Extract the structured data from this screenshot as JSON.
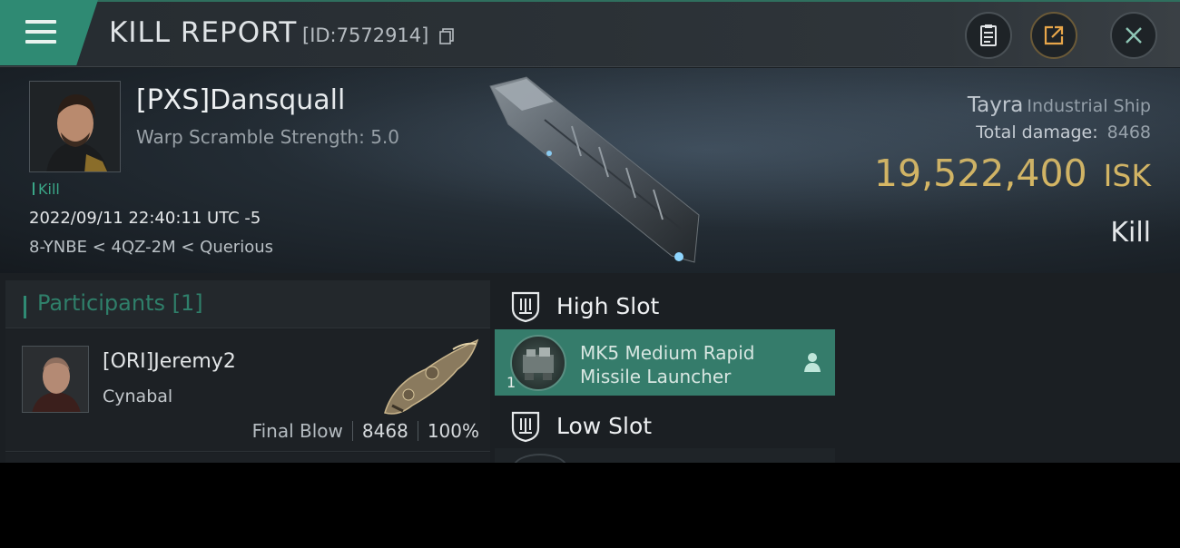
{
  "header": {
    "title": "KILL REPORT",
    "report_id": "[ID:7572914]",
    "icons": [
      "hamburger-menu-icon",
      "clipboard-icon",
      "share-icon",
      "close-icon"
    ]
  },
  "victim": {
    "name": "[PXS]Dansquall",
    "subtitle": "Warp Scramble Strength: 5.0",
    "kill_tag": "Kill",
    "datetime": "2022/09/11 22:40:11 UTC -5",
    "location": "8-YNBE < 4QZ-2M < Querious",
    "ship_name": "Tayra",
    "ship_class": "Industrial Ship",
    "total_damage_label": "Total damage:",
    "total_damage": "8468",
    "isk_value": "19,522,400",
    "isk_unit": "ISK",
    "result": "Kill"
  },
  "participants": {
    "title": "Participants [1]",
    "items": [
      {
        "name": "[ORI]Jeremy2",
        "ship": "Cynabal",
        "final_blow_label": "Final Blow",
        "damage": "8468",
        "percent": "100%"
      }
    ]
  },
  "slots": {
    "high": {
      "title": "High Slot",
      "items": [
        {
          "qty": "1",
          "name": "MK5 Medium Rapid Missile Launcher"
        }
      ]
    },
    "low": {
      "title": "Low Slot"
    }
  },
  "colors": {
    "accent": "#2f8a73",
    "isk": "#e9c25f",
    "slot_selected": "#357c6b"
  }
}
